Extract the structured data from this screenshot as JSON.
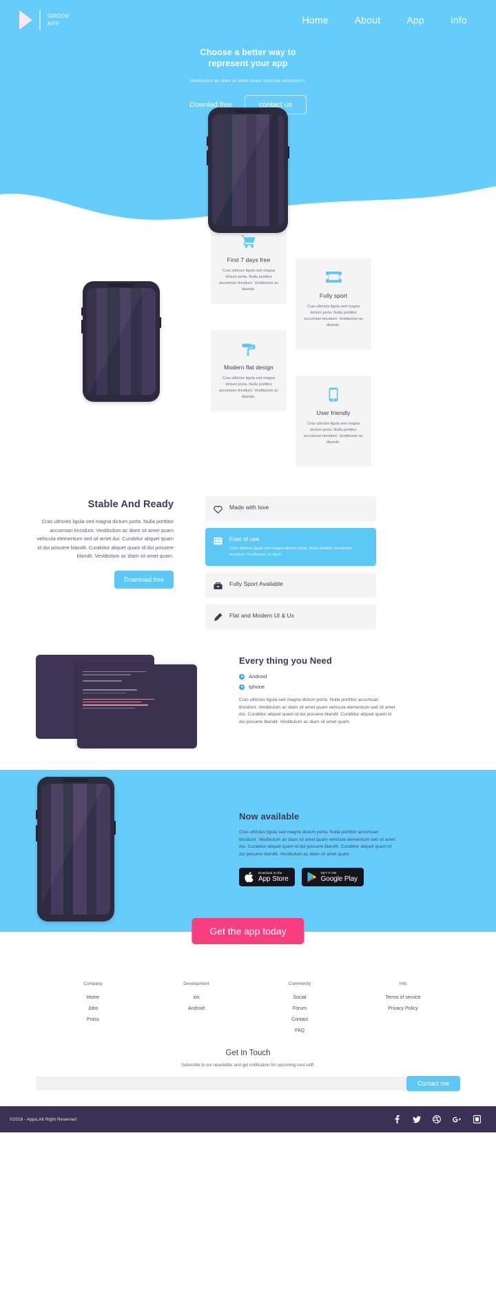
{
  "brand": {
    "name_line1": "GROOV",
    "name_line2": "APP",
    "logo_icon": "play-triangle-icon"
  },
  "nav": {
    "items": [
      "Home",
      "About",
      "App",
      "Info"
    ]
  },
  "hero": {
    "title_line1": "Choose a better way to",
    "title_line2": "represent your app",
    "subtitle": "Vestibulum ac diam sit amet quam vehicula elementum.",
    "download_label": "Downlad free",
    "contact_label": "contact us",
    "bg_color": "#66ccfa"
  },
  "features": {
    "cards": [
      {
        "icon": "shopping-cart-icon",
        "title": "First 7 days free",
        "text": "Cras ultricies ligula sed magna dictum porta. Nulla porttitor accumsan tincidunt. Vestibulum ac diamdo."
      },
      {
        "icon": "ticket-icon",
        "title": "Fully sport",
        "text": "Cras ultricies ligula sed magna dictum porta. Nulla porttitor accumsan tincidunt. Vestibulum ac diamdo."
      },
      {
        "icon": "paint-roller-icon",
        "title": "Modern flat design",
        "text": "Cras ultricies ligula sed magna dictum porta. Nulla porttitor accumsan tincidunt. Vestibulum ac diamdo."
      },
      {
        "icon": "mobile-phone-icon",
        "title": "User friendly",
        "text": "Cras ultricies ligula sed magna dictum porta. Nulla porttitor accumsan tincidunt. Vestibulum ac diamdo."
      }
    ]
  },
  "stable": {
    "heading": "Stable And Ready",
    "paragraph": "Cras ultricies ligula sed magna dictum porta. Nulla porttitor accumsan tincidunt. Vestibulum ac diam sit amet quam vehicula elementum sed sit amet dui. Curabitur aliquet quam id dui posuere blandit. Curabitur aliquet quam id dui posuere blandit. Vestibulum ac diam sit amet quam.",
    "button_label": "Download free",
    "accordion": [
      {
        "icon": "heart-icon",
        "title": "Made with love",
        "body": "",
        "active": false
      },
      {
        "icon": "list-icon",
        "title": "Free of use",
        "body": "Cras ultricies ligula sed magna dictum porta. Nulla porttitor accumsan tincidunt. Vestibulum ac diam.",
        "active": true
      },
      {
        "icon": "briefcase-icon",
        "title": "Fully Sport Available",
        "body": "",
        "active": false
      },
      {
        "icon": "pencil-icon",
        "title": "Flat and Modern Ul & Ux",
        "body": "",
        "active": false
      }
    ]
  },
  "everything": {
    "heading": "Every thing you Need",
    "options": [
      "Android",
      "Iphone"
    ],
    "paragraph": "Cras ultricies ligula sed magna dictum porta. Nulla porttitor accumsan tincidunt. Vestibulum ac diam sit amet quam vehicula elementum sed sit amet dui. Curabitur aliquet quam id dui posuere blandit. Curabitur aliquet quam id dui posuere blandit. Vestibulum ac diam sit amet quam."
  },
  "available": {
    "heading": "Now available",
    "paragraph": "Cras ultricies ligula sed magna dictum porta. Nulla porttitor accumsan tincidunt. Vestibulum ac diam sit amet quam vehicula elementum sed sit amet dui. Curabitur aliquet quam id dui posuere blandit. Curabitur aliquet quam id dui posuere blandit. Vestibulum ac diam sit amet quam.",
    "appstore": {
      "icon": "apple-icon",
      "small": "Download on the",
      "large": "App Store"
    },
    "googleplay": {
      "icon": "google-play-icon",
      "small": "GET IT ON",
      "large": "Google Play"
    }
  },
  "cta": {
    "label": "Get the app today",
    "color": "#f73f7f"
  },
  "footer": {
    "columns": [
      {
        "heading": "Company",
        "links": [
          "Home",
          "Jobs",
          "Prass"
        ]
      },
      {
        "heading": "Development",
        "links": [
          "ios",
          "Android"
        ]
      },
      {
        "heading": "Commenity",
        "links": [
          "Social",
          "Forum",
          "Contact",
          "FAQ"
        ]
      },
      {
        "heading": "Info",
        "links": [
          "Terms of service",
          "Privacy Policy"
        ]
      }
    ],
    "touch_heading": "Get In Touch",
    "touch_sub": "Subscribe to our newsletter and get notification for upcoming cool sutff.",
    "input_placeholder": "",
    "input_value": "",
    "contact_button": "Contact me",
    "copyright": "©2018 - Appo,All Right Reserved",
    "socials": [
      "facebook-icon",
      "twitter-icon",
      "dribbble-icon",
      "google-plus-icon",
      "app-box-icon"
    ]
  }
}
